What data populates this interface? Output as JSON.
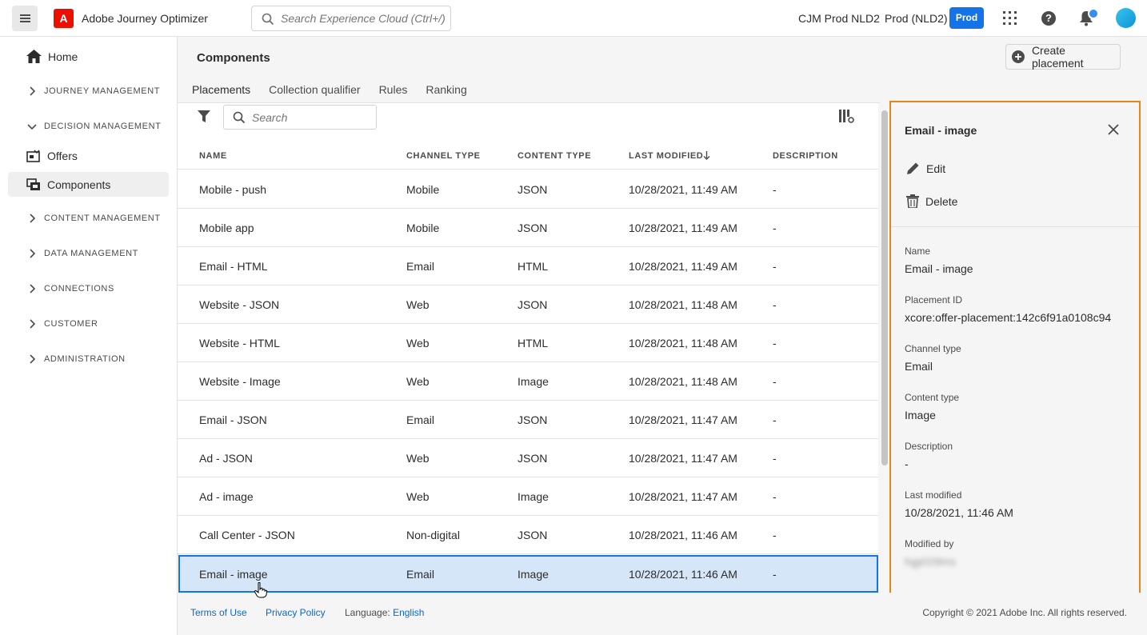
{
  "header": {
    "app_title": "Adobe Journey Optimizer",
    "search_placeholder": "Search Experience Cloud (Ctrl+/)",
    "org": "CJM Prod NLD2",
    "sandbox": "Prod (NLD2)",
    "badge": "Prod",
    "logo_letter": "A",
    "help_glyph": "?"
  },
  "sidebar": {
    "home": "Home",
    "sections": [
      {
        "label": "JOURNEY MANAGEMENT",
        "expanded": false
      },
      {
        "label": "DECISION MANAGEMENT",
        "expanded": true
      },
      {
        "label": "CONTENT MANAGEMENT",
        "expanded": false
      },
      {
        "label": "DATA MANAGEMENT",
        "expanded": false
      },
      {
        "label": "CONNECTIONS",
        "expanded": false
      },
      {
        "label": "CUSTOMER",
        "expanded": false
      },
      {
        "label": "ADMINISTRATION",
        "expanded": false
      }
    ],
    "decision_items": [
      {
        "label": "Offers",
        "active": false
      },
      {
        "label": "Components",
        "active": true
      }
    ]
  },
  "main": {
    "title": "Components",
    "create_button": "Create placement",
    "tabs": [
      "Placements",
      "Collection qualifier",
      "Rules",
      "Ranking"
    ],
    "active_tab": "Placements",
    "search_placeholder": "Search",
    "columns": [
      "NAME",
      "CHANNEL TYPE",
      "CONTENT TYPE",
      "LAST MODIFIED",
      "DESCRIPTION"
    ],
    "sort_column": "LAST MODIFIED",
    "sort_direction": "descending",
    "rows": [
      {
        "name": "Mobile - push",
        "channel": "Mobile",
        "content": "JSON",
        "modified": "10/28/2021, 11:49 AM",
        "description": "-"
      },
      {
        "name": "Mobile app",
        "channel": "Mobile",
        "content": "JSON",
        "modified": "10/28/2021, 11:49 AM",
        "description": "-"
      },
      {
        "name": "Email - HTML",
        "channel": "Email",
        "content": "HTML",
        "modified": "10/28/2021, 11:49 AM",
        "description": "-"
      },
      {
        "name": "Website - JSON",
        "channel": "Web",
        "content": "JSON",
        "modified": "10/28/2021, 11:48 AM",
        "description": "-"
      },
      {
        "name": "Website - HTML",
        "channel": "Web",
        "content": "HTML",
        "modified": "10/28/2021, 11:48 AM",
        "description": "-"
      },
      {
        "name": "Website - Image",
        "channel": "Web",
        "content": "Image",
        "modified": "10/28/2021, 11:48 AM",
        "description": "-"
      },
      {
        "name": "Email - JSON",
        "channel": "Email",
        "content": "JSON",
        "modified": "10/28/2021, 11:47 AM",
        "description": "-"
      },
      {
        "name": "Ad - JSON",
        "channel": "Web",
        "content": "JSON",
        "modified": "10/28/2021, 11:47 AM",
        "description": "-"
      },
      {
        "name": "Ad - image",
        "channel": "Web",
        "content": "Image",
        "modified": "10/28/2021, 11:47 AM",
        "description": "-"
      },
      {
        "name": "Call Center - JSON",
        "channel": "Non-digital",
        "content": "JSON",
        "modified": "10/28/2021, 11:46 AM",
        "description": "-"
      },
      {
        "name": "Email - image",
        "channel": "Email",
        "content": "Image",
        "modified": "10/28/2021, 11:46 AM",
        "description": "-",
        "selected": true
      }
    ]
  },
  "panel": {
    "title": "Email - image",
    "edit": "Edit",
    "delete": "Delete",
    "props": [
      {
        "label": "Name",
        "value": "Email - image"
      },
      {
        "label": "Placement ID",
        "value": "xcore:offer-placement:142c6f91a0108c94"
      },
      {
        "label": "Channel type",
        "value": "Email"
      },
      {
        "label": "Content type",
        "value": "Image"
      },
      {
        "label": "Description",
        "value": "-"
      },
      {
        "label": "Last modified",
        "value": "10/28/2021, 11:46 AM"
      },
      {
        "label": "Modified by",
        "value": "hgjd1l9ms"
      }
    ]
  },
  "footer": {
    "terms": "Terms of Use",
    "privacy": "Privacy Policy",
    "language_label": "Language:",
    "language": "English",
    "copyright": "Copyright ©  2021 Adobe Inc.  All rights reserved."
  },
  "colors": {
    "accent": "#1473e6",
    "panel_highlight": "#e68619",
    "selected_row": "#d5e6f9",
    "adobe_red": "#eb1000"
  }
}
